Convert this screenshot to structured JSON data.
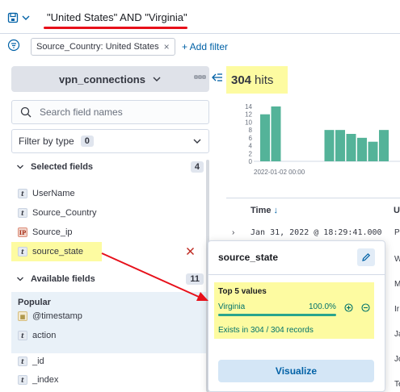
{
  "query": {
    "text": "\"United States\" AND \"Virginia\""
  },
  "filters": {
    "pills": [
      {
        "label": "Source_Country: United States"
      }
    ],
    "add_filter_label": "+ Add filter"
  },
  "sidebar": {
    "index_pattern": "vpn_connections",
    "search_placeholder": "Search field names",
    "filter_by_type_label": "Filter by type",
    "filter_by_type_count": "0",
    "selected_fields": {
      "label": "Selected fields",
      "count": "4",
      "items": [
        {
          "name": "UserName",
          "type": "t"
        },
        {
          "name": "Source_Country",
          "type": "t"
        },
        {
          "name": "Source_ip",
          "type": "IP"
        },
        {
          "name": "source_state",
          "type": "t"
        }
      ]
    },
    "available_fields": {
      "label": "Available fields",
      "count": "11",
      "popular_label": "Popular",
      "popular": [
        {
          "name": "@timestamp",
          "type": "date"
        },
        {
          "name": "action",
          "type": "t"
        }
      ],
      "items": [
        {
          "name": "_id",
          "type": "t"
        },
        {
          "name": "_index",
          "type": "t"
        }
      ]
    }
  },
  "results": {
    "hits_count": "304",
    "hits_label": "hits",
    "x_tick_label": "2022-01-02 00:00",
    "table": {
      "time_header": "Time",
      "next_header_fragment": "U",
      "rows": [
        {
          "time": "Jan 31, 2022 @ 18:29:41.000",
          "edge_text": "Pl"
        }
      ],
      "edge_texts": [
        "W",
        "Ma",
        "Ir",
        "Ja",
        "Jo",
        "Te"
      ]
    }
  },
  "popover": {
    "title": "source_state",
    "top_values_label": "Top 5 values",
    "value": "Virginia",
    "percent": "100.0%",
    "percent_fraction": 1.0,
    "exists_text": "Exists in 304 / 304 records",
    "visualize_label": "Visualize"
  },
  "chart_data": {
    "type": "bar",
    "x": [
      "bar1",
      "bar2",
      "bar3",
      "bar4",
      "bar5",
      "bar6",
      "bar7",
      "bar8",
      "bar9",
      "bar10"
    ],
    "values": [
      12,
      14,
      0,
      0,
      8,
      8,
      7,
      6,
      5,
      8
    ],
    "yticks": [
      0,
      2,
      4,
      6,
      8,
      10,
      12,
      14
    ],
    "ylim": [
      0,
      14
    ],
    "xlabel_ticks": [
      "2022-01-02 00:00"
    ],
    "bar_color": "#54b399"
  },
  "colors": {
    "accent": "#0061a6",
    "highlight": "#fdfba1",
    "annotation_red": "#e7101a",
    "success": "#00726b"
  }
}
